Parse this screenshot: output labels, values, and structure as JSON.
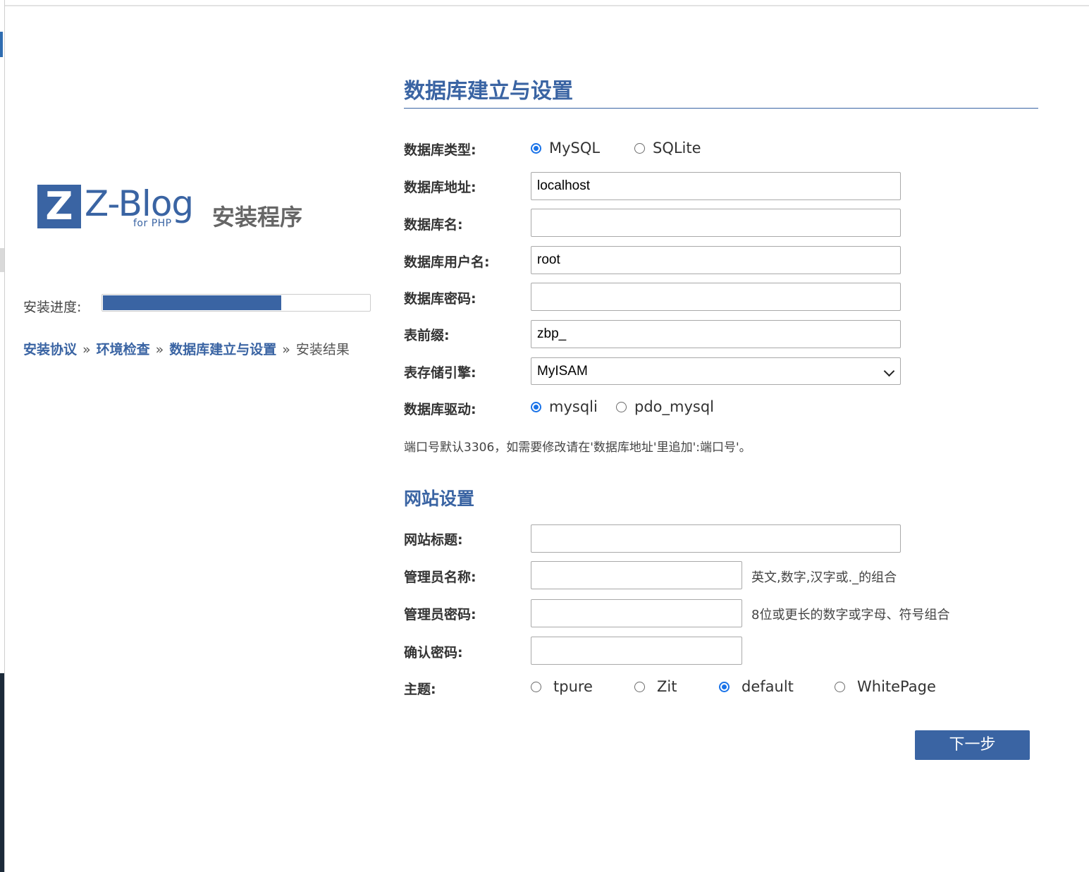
{
  "colors": {
    "accent": "#3a64a3",
    "radio_checked": "#1a73e8"
  },
  "logo": {
    "mark": "Z",
    "name": "Z-Blog",
    "sub": "for PHP",
    "install": "安装程序"
  },
  "progress": {
    "label": "安装进度:",
    "percent": 67
  },
  "steps": [
    {
      "label": "安装协议",
      "done": true
    },
    {
      "label": "环境检查",
      "done": true
    },
    {
      "label": "数据库建立与设置",
      "done": true
    },
    {
      "label": "安装结果",
      "done": false
    }
  ],
  "steps_sep": "»",
  "db": {
    "title": "数据库建立与设置",
    "type_label": "数据库类型:",
    "type_options": [
      "MySQL",
      "SQLite"
    ],
    "type_selected": "MySQL",
    "host_label": "数据库地址:",
    "host_value": "localhost",
    "name_label": "数据库名:",
    "name_value": "",
    "user_label": "数据库用户名:",
    "user_value": "root",
    "password_label": "数据库密码:",
    "password_value": "",
    "prefix_label": "表前缀:",
    "prefix_value": "zbp_",
    "engine_label": "表存储引擎:",
    "engine_value": "MyISAM",
    "driver_label": "数据库驱动:",
    "driver_options": [
      "mysqli",
      "pdo_mysql"
    ],
    "driver_selected": "mysqli",
    "port_hint": "端口号默认3306，如需要修改请在'数据库地址'里追加':端口号'。"
  },
  "site": {
    "title": "网站设置",
    "site_title_label": "网站标题:",
    "site_title_value": "",
    "admin_name_label": "管理员名称:",
    "admin_name_value": "",
    "admin_name_hint": "英文,数字,汉字或._的组合",
    "admin_password_label": "管理员密码:",
    "admin_password_value": "",
    "admin_password_hint": "8位或更长的数字或字母、符号组合",
    "confirm_label": "确认密码:",
    "confirm_value": "",
    "theme_label": "主题:",
    "theme_options": [
      "tpure",
      "Zit",
      "default",
      "WhitePage"
    ],
    "theme_selected": "default"
  },
  "next_button": "下一步"
}
